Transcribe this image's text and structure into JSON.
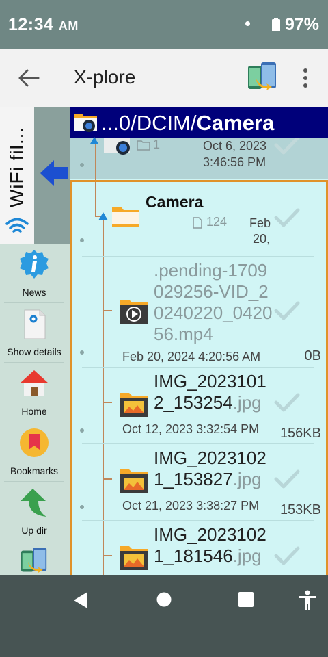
{
  "status_bar": {
    "time": "12:34",
    "ampm": "AM",
    "battery": "97%"
  },
  "app_bar": {
    "title": "X-plore"
  },
  "sidebar": {
    "wifi_tab_label": "WiFi fil...",
    "items": [
      {
        "label": "News",
        "icon": "info-icon"
      },
      {
        "label": "Show details",
        "icon": "document-icon"
      },
      {
        "label": "Home",
        "icon": "home-icon"
      },
      {
        "label": "Bookmarks",
        "icon": "bookmark-icon"
      },
      {
        "label": "Up dir",
        "icon": "up-arrow-icon"
      }
    ]
  },
  "path_bar": {
    "prefix": "...0/DCIM/",
    "current": "Camera"
  },
  "parent_entry": {
    "count": "1",
    "date_line1": "Oct 6, 2023",
    "date_line2": "3:46:56 PM"
  },
  "current_folder": {
    "name": "Camera",
    "count": "124",
    "date_line1": "Feb",
    "date_line2": "20,"
  },
  "files": [
    {
      "name_lines": [
        ".pending-1709",
        "029256-VID_2",
        "0240220_0420",
        "56.mp4"
      ],
      "ext": "",
      "date": "Feb 20, 2024 4:20:56 AM",
      "size": "0B",
      "type": "video-file-icon"
    },
    {
      "name_lines": [
        "IMG_2023101",
        "2_153254"
      ],
      "ext": ".jpg",
      "date": "Oct 12, 2023 3:32:54 PM",
      "size": "156KB",
      "type": "image-file-icon"
    },
    {
      "name_lines": [
        "IMG_2023102",
        "1_153827"
      ],
      "ext": ".jpg",
      "date": "Oct 21, 2023 3:38:27 PM",
      "size": "153KB",
      "type": "image-file-icon"
    },
    {
      "name_lines": [
        "IMG_2023102",
        "1_181546"
      ],
      "ext": ".jpg",
      "date": "",
      "size": "",
      "type": "image-file-icon"
    }
  ],
  "colors": {
    "status_bar": "#6f8784",
    "path_bar": "#00007a",
    "list_bg": "#d1f5f5",
    "selection_border": "#e0922a",
    "nav_bar": "#475453"
  }
}
